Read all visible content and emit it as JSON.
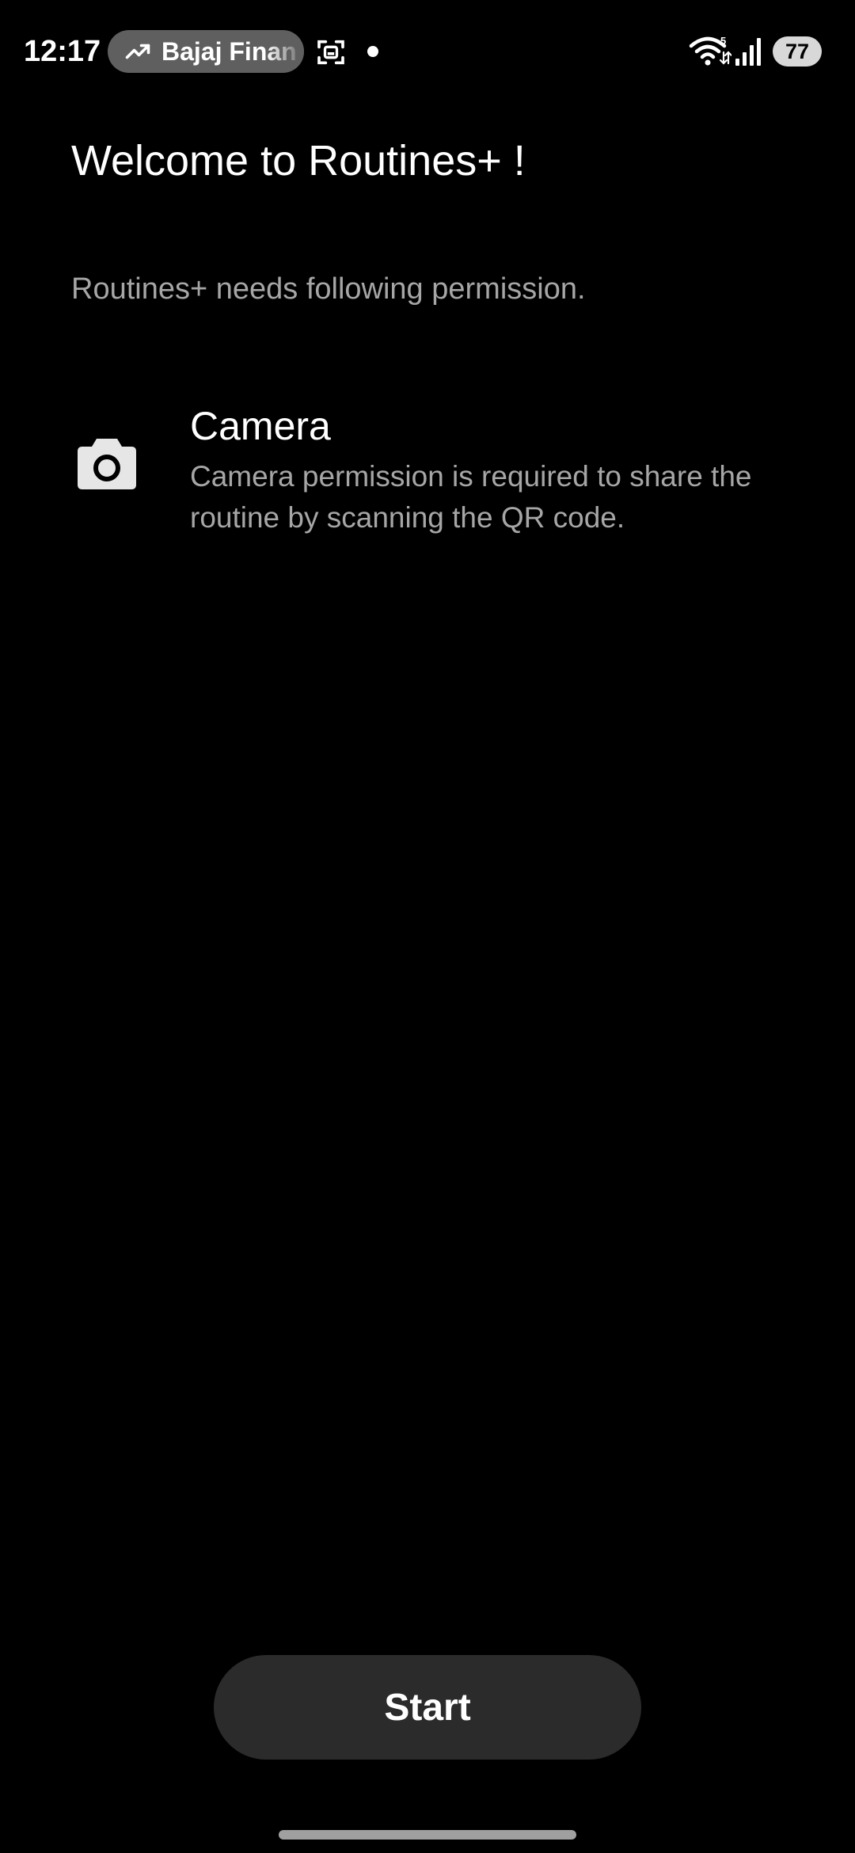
{
  "status_bar": {
    "time": "12:17",
    "live_notification": {
      "text": "Bajaj Finan",
      "icon": "trending-up-icon"
    },
    "icons": [
      "screenshot-scan-icon",
      "notification-dot",
      "wifi-icon",
      "signal-icon"
    ],
    "wifi_badge": "5",
    "battery_level": "77"
  },
  "welcome": {
    "title": "Welcome to Routines+ !",
    "subtitle": "Routines+ needs following permission."
  },
  "permissions": [
    {
      "icon": "camera-icon",
      "title": "Camera",
      "description": "Camera permission is required to share the routine by scanning the QR code."
    }
  ],
  "actions": {
    "start_label": "Start"
  },
  "colors": {
    "background": "#000000",
    "primary_text": "#ffffff",
    "secondary_text": "#a6a6a6",
    "button_background": "#2b2b2b",
    "pill_background": "#5f5f5f"
  }
}
